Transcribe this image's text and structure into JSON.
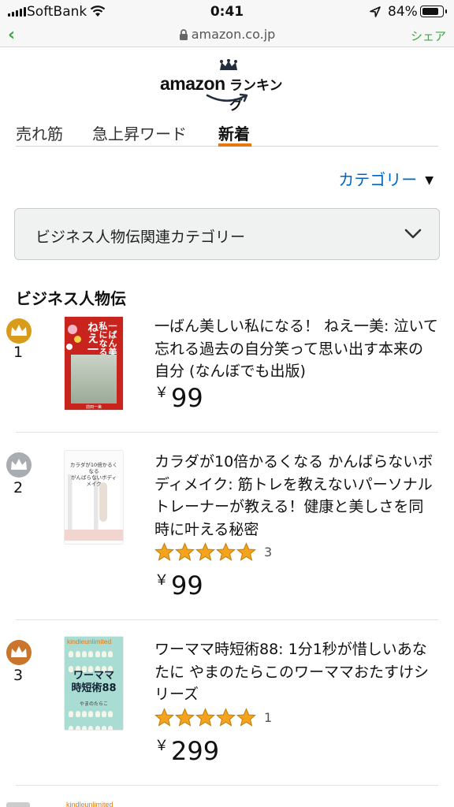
{
  "status_bar": {
    "carrier": "SoftBank",
    "time": "0:41",
    "battery": "84%",
    "battery_level": 0.84
  },
  "browser": {
    "url": "amazon.co.jp",
    "share": "シェア"
  },
  "logo": {
    "brand": "amazon",
    "subtitle": "ランキング"
  },
  "tabs": [
    {
      "label": "売れ筋",
      "active": false
    },
    {
      "label": "急上昇ワード",
      "active": false
    },
    {
      "label": "新着",
      "active": true
    }
  ],
  "category_link": {
    "label": "カテゴリー",
    "caret": "▼"
  },
  "dropdown": {
    "label": "ビジネス人物伝関連カテゴリー"
  },
  "section_title": "ビジネス人物伝",
  "items": [
    {
      "rank": "1",
      "badge": "gold-crown-icon",
      "title": "一ばん美しい私になる！ ねえ一美: 泣いて忘れる過去の自分笑って思い出す本来の自分 (なんぼでも出版)",
      "price": "99",
      "currency": "￥",
      "rating": null,
      "review_count": null
    },
    {
      "rank": "2",
      "badge": "silver-crown-icon",
      "title": "カラダが10倍かるくなる かんばらないボディメイク: 筋トレを教えないパーソナルトレーナーが教える！健康と美しさを同時に叶える秘密",
      "price": "99",
      "currency": "￥",
      "rating": 5,
      "review_count": "3"
    },
    {
      "rank": "3",
      "badge": "bronze-crown-icon",
      "title": "ワーママ時短術88: 1分1秒が惜しいあなたに やまのたらこのワーママおたすけシリーズ",
      "price": "299",
      "currency": "￥",
      "rating": 5,
      "review_count": "1"
    }
  ],
  "covers": {
    "c1": {
      "line1": "一ばん美しい",
      "line2": "私になる！",
      "big": "ねえ一美",
      "author": "前田一美"
    },
    "c2": {
      "line1": "カラダが10倍かるくなる",
      "line2": "がんばらないボディメイク"
    },
    "c3": {
      "badge": "kindleunlimited",
      "title1": "ワーママ",
      "title2": "時短術88",
      "author": "やまのたらこ"
    }
  },
  "next_item": {
    "badge": "kindleunlimited"
  },
  "colors": {
    "accent": "#e47911",
    "link": "#0066c0",
    "safari_green": "#3ca746",
    "gold": "#d89b1a",
    "silver": "#a8adb2",
    "bronze": "#c9752b",
    "star": "#f4a41c"
  }
}
